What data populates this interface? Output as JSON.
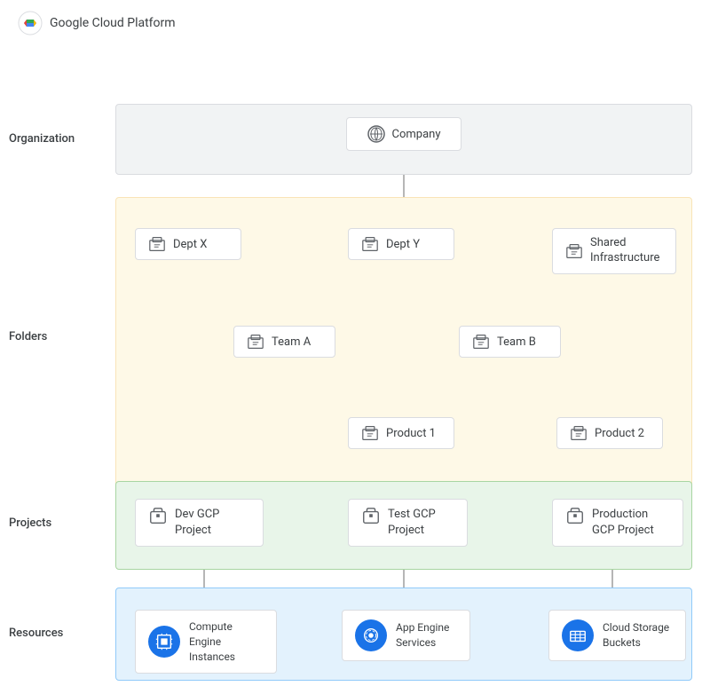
{
  "app": {
    "logo_text": "Google Cloud Platform"
  },
  "labels": {
    "organization": "Organization",
    "folders": "Folders",
    "projects": "Projects",
    "resources": "Resources"
  },
  "nodes": {
    "company": {
      "label": "Company",
      "icon": "org"
    },
    "dept_x": {
      "label": "Dept X",
      "icon": "folder"
    },
    "dept_y": {
      "label": "Dept Y",
      "icon": "folder"
    },
    "shared_infra": {
      "label": "Shared\nInfrastructure",
      "icon": "folder"
    },
    "team_a": {
      "label": "Team A",
      "icon": "folder"
    },
    "team_b": {
      "label": "Team B",
      "icon": "folder"
    },
    "product_1": {
      "label": "Product 1",
      "icon": "folder"
    },
    "product_2": {
      "label": "Product 2",
      "icon": "folder"
    },
    "dev_gcp": {
      "label": "Dev GCP\nProject",
      "icon": "project"
    },
    "test_gcp": {
      "label": "Test GCP\nProject",
      "icon": "project"
    },
    "prod_gcp": {
      "label": "Production\nGCP Project",
      "icon": "project"
    }
  },
  "resources": {
    "compute": {
      "label": "Compute Engine\nInstances",
      "icon": "compute"
    },
    "app_engine": {
      "label": "App Engine\nServices",
      "icon": "app_engine"
    },
    "cloud_storage": {
      "label": "Cloud Storage\nBuckets",
      "icon": "storage"
    }
  }
}
